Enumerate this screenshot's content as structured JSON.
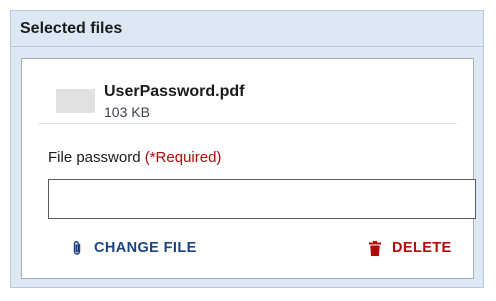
{
  "panel": {
    "title": "Selected files"
  },
  "file": {
    "name": "UserPassword.pdf",
    "size": "103 KB"
  },
  "password_field": {
    "label": "File password",
    "required_note": "(*Required)",
    "value": "",
    "placeholder": ""
  },
  "actions": {
    "change_label": "CHANGE FILE",
    "change_icon": "paperclip-icon",
    "delete_label": "DELETE",
    "delete_icon": "trash-icon"
  },
  "colors": {
    "panel_bg": "#dde8f5",
    "link_blue": "#1a4480",
    "danger_red": "#b50909"
  }
}
